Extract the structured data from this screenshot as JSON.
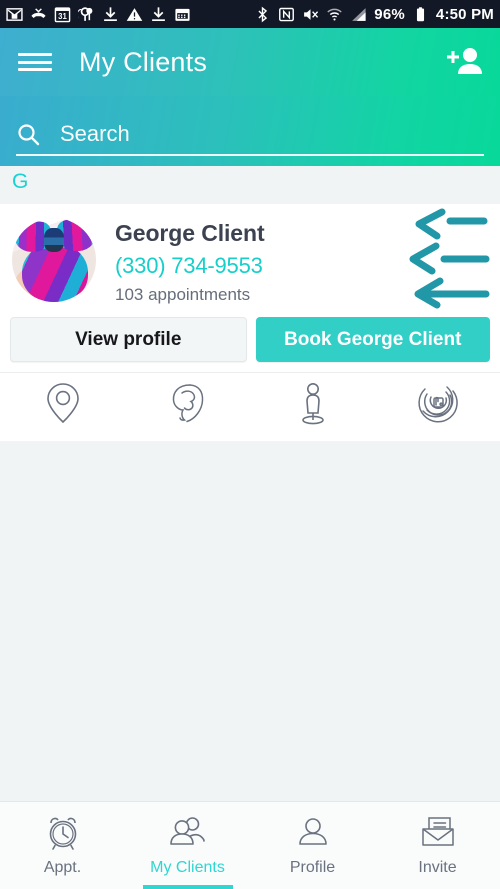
{
  "status_bar": {
    "left_icons": [
      "gmail-icon",
      "missed-call-icon",
      "calendar-31-icon",
      "google-maps-icon",
      "download-icon",
      "warning-icon",
      "download-icon-2",
      "ticket-calendar-icon"
    ],
    "right_icons": [
      "bluetooth-icon",
      "nfc-icon",
      "mute-icon",
      "wifi-icon",
      "cellular-signal-icon"
    ],
    "battery_percent": "96%",
    "time": "4:50 PM"
  },
  "app_bar": {
    "menu_icon": "hamburger-menu-icon",
    "title": "My Clients",
    "action_icon": "add-person-icon",
    "gradient_start": "#3FAED0",
    "gradient_end": "#08D89A"
  },
  "search": {
    "icon": "search-icon",
    "value": "",
    "placeholder": "Search"
  },
  "list": {
    "section_letter": "G",
    "client": {
      "avatar": "client-avatar-colorful-hair",
      "name": "George Client",
      "phone": "(330) 734-9553",
      "appointments": "103 appointments",
      "buttons": {
        "view_profile": "View profile",
        "book": "Book George Client"
      },
      "quick_icons": [
        {
          "name": "location-pin-icon"
        },
        {
          "name": "hairstyle-head-icon"
        },
        {
          "name": "person-standing-icon"
        },
        {
          "name": "spiral-circles-icon"
        }
      ],
      "annotation": "three-left-arrows-annotation"
    }
  },
  "bottom_nav": {
    "items": [
      {
        "label": "Appt.",
        "icon": "alarm-clock-icon",
        "active": false
      },
      {
        "label": "My Clients",
        "icon": "two-people-icon",
        "active": true
      },
      {
        "label": "Profile",
        "icon": "person-icon",
        "active": false
      },
      {
        "label": "Invite",
        "icon": "envelope-letter-icon",
        "active": false
      }
    ],
    "active_color": "#2FD6D2"
  },
  "colors": {
    "accent_teal": "#17CFC9",
    "primary_button": "#31CFC6",
    "page_background": "#F1F4F5",
    "card_background": "#FFFFFF",
    "text_dark": "#3C4250",
    "annotation_teal": "#0F8FA0"
  }
}
